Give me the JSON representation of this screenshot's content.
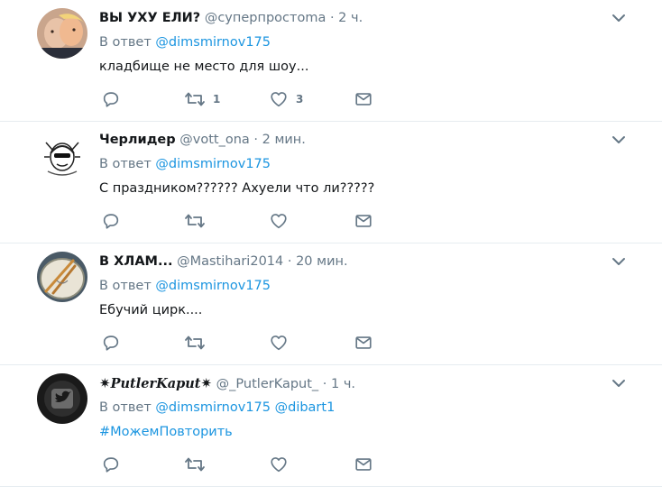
{
  "tweets": [
    {
      "name": "ВЫ УХУ ЕЛИ?",
      "handle": "@сyпepпpocтoma",
      "dot": "·",
      "time": "2 ч.",
      "reply_prefix": "В ответ",
      "mentions": [
        "@dimsmirnov175"
      ],
      "text": "кладбище не место для шоу...",
      "retweet_count": "1",
      "like_count": "3",
      "avatar": "photo-avatar"
    },
    {
      "name": "Черлидер",
      "handle": "@vott_ona",
      "dot": "·",
      "time": "2 мин.",
      "reply_prefix": "В ответ",
      "mentions": [
        "@dimsmirnov175"
      ],
      "text": "С праздником?????? Ахуели что ли?????",
      "retweet_count": "",
      "like_count": "",
      "avatar": "sketch-avatar"
    },
    {
      "name": "В ХЛАМ...",
      "handle": "@Mastihari2014",
      "dot": "·",
      "time": "20 мин.",
      "reply_prefix": "В ответ",
      "mentions": [
        "@dimsmirnov175"
      ],
      "text": "Ебучий цирк....",
      "retweet_count": "",
      "like_count": "",
      "avatar": "drum-avatar"
    },
    {
      "name": "PutlerKaput",
      "handle": "@_PutlerKaput_",
      "dot": "·",
      "time": "1 ч.",
      "reply_prefix": "В ответ",
      "mentions": [
        "@dimsmirnov175",
        "@dibart1"
      ],
      "text": "#МожемПовторить",
      "retweet_count": "",
      "like_count": "",
      "avatar": "bird-avatar"
    }
  ],
  "icons": {
    "reply": "reply-icon",
    "retweet": "retweet-icon",
    "like": "heart-icon",
    "dm": "envelope-icon",
    "menu": "chevron-down-icon",
    "name_ornament": "star-icon"
  },
  "colors": {
    "link": "#1b95e0",
    "secondary": "#657786",
    "primary_text": "#14171a",
    "divider": "#e6ecf0"
  }
}
